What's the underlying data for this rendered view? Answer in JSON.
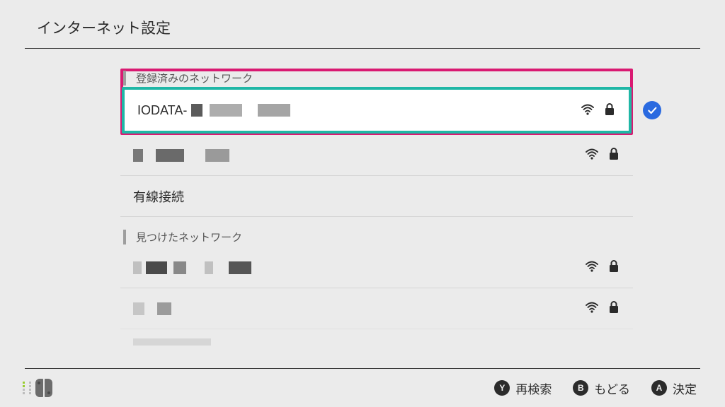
{
  "header": {
    "title": "インターネット設定"
  },
  "sections": {
    "registered": {
      "label": "登録済みのネットワーク"
    },
    "found": {
      "label": "見つけたネットワーク"
    }
  },
  "networks": {
    "selected": {
      "name_prefix": "IODATA-",
      "has_wifi": true,
      "has_lock": true,
      "checked": true
    },
    "registered_second": {
      "has_wifi": true,
      "has_lock": true
    },
    "wired": {
      "label": "有線接続"
    },
    "found_1": {
      "has_wifi": true,
      "has_lock": true
    },
    "found_2": {
      "has_wifi": true,
      "has_lock": true
    }
  },
  "footer": {
    "actions": {
      "y": {
        "key": "Y",
        "label": "再検索"
      },
      "b": {
        "key": "B",
        "label": "もどる"
      },
      "a": {
        "key": "A",
        "label": "決定"
      }
    }
  },
  "colors": {
    "highlight_outer": "#d91a72",
    "highlight_inner": "#1fb7a6",
    "check": "#2a6ae0"
  }
}
